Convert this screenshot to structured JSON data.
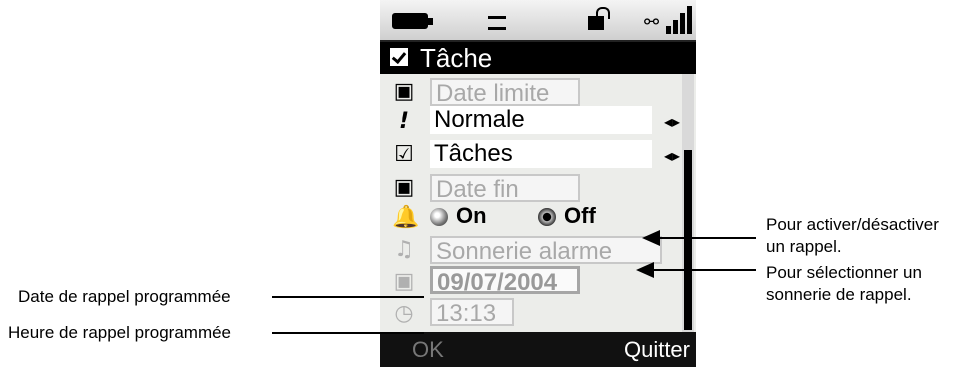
{
  "title": "Tâche",
  "fields": {
    "due_date": "Date limite",
    "priority": "Normale",
    "category": "Tâches",
    "end_date": "Date fin",
    "reminder_on": "On",
    "reminder_off": "Off",
    "ringtone": "Sonnerie alarme",
    "reminder_date": "09/07/2004",
    "reminder_time": "13:13"
  },
  "softkeys": {
    "left": "OK",
    "right": "Quitter"
  },
  "annotations": {
    "toggle_line1": "Pour activer/désactiver",
    "toggle_line2": "un rappel.",
    "ringtone_line1": "Pour sélectionner un",
    "ringtone_line2": "sonnerie de rappel.",
    "date_note": "Date de rappel programmée",
    "time_note": "Heure de rappel programmée"
  }
}
